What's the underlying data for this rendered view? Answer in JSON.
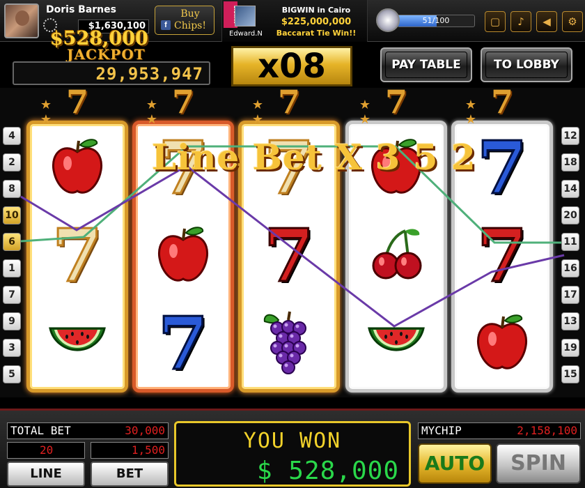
{
  "player": {
    "name": "Doris Barnes",
    "chips": "$1,630,100"
  },
  "buy": {
    "label": "Buy Chips!",
    "fb_icon": "f"
  },
  "notice": {
    "badge": "BIGWIN",
    "user": "Edward.N",
    "line1": "BIGWIN in Cairo",
    "line2": "$225,000,000",
    "line3": "Baccarat Tie Win!!"
  },
  "level": {
    "text": "51/100",
    "progress": 0.51
  },
  "topbar_icons": [
    "window-icon",
    "music-icon",
    "sound-icon",
    "settings-icon"
  ],
  "jackpot": {
    "win": "$528,000",
    "label": "JACKPOT",
    "amount": "29,953,947"
  },
  "multiplier": "x08",
  "buttons": {
    "paytable": "PAY TABLE",
    "lobby": "TO LOBBY",
    "line": "LINE",
    "bet": "BET",
    "auto": "AUTO",
    "spin": "SPIN"
  },
  "left_lines": [
    "4",
    "2",
    "8",
    "10",
    "6",
    "1",
    "7",
    "9",
    "3",
    "5"
  ],
  "right_lines": [
    "12",
    "18",
    "14",
    "20",
    "11",
    "16",
    "17",
    "13",
    "19",
    "15"
  ],
  "reels": [
    {
      "top": "7",
      "symbols": [
        "apple",
        "seven-gold",
        "watermelon"
      ]
    },
    {
      "top": "7",
      "symbols": [
        "seven-gold",
        "apple",
        "seven-blue"
      ]
    },
    {
      "top": "7",
      "symbols": [
        "seven-gold",
        "seven-red",
        "grapes"
      ]
    },
    {
      "top": "7",
      "symbols": [
        "apple",
        "cherries",
        "watermelon"
      ]
    },
    {
      "top": "7",
      "symbols": [
        "seven-blue",
        "seven-red",
        "apple"
      ]
    }
  ],
  "overlay": "Line Bet  X 3 5 2",
  "panel": {
    "total_bet_label": "TOTAL BET",
    "total_bet": "30,000",
    "lines": "20",
    "bet": "1,500",
    "you_won_label": "YOU WON",
    "you_won": "$ 528,000",
    "mychip_label": "MYCHIP",
    "mychip": "2,158,100"
  },
  "colors": {
    "gold": "#f2c24a",
    "red_digits": "#e02020",
    "green_digits": "#2ad84a"
  }
}
